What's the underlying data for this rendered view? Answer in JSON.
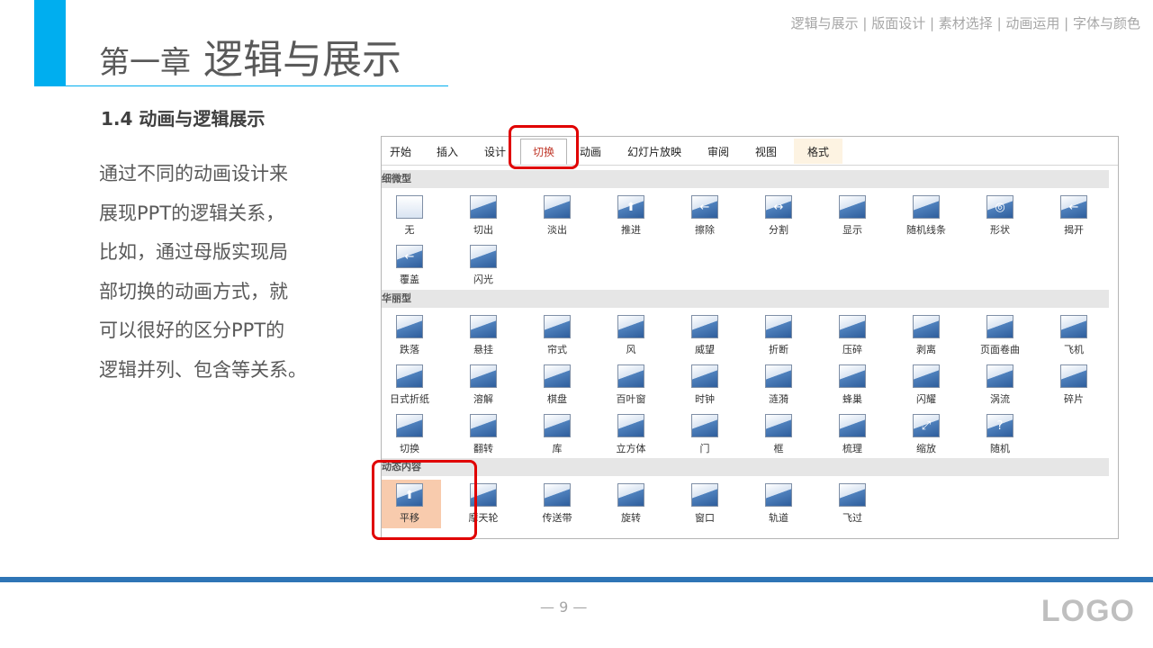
{
  "header": {
    "chapter": "第一章",
    "title": "逻辑与展示",
    "nav": "逻辑与展示 | 版面设计 | 素材选择 | 动画运用 | 字体与颜色"
  },
  "section_title": "1.4 动画与逻辑展示",
  "body_lines": [
    "通过不同的动画设计来",
    "展现PPT的逻辑关系，",
    "比如，通过母版实现局",
    "部切换的动画方式，就",
    "可以很好的区分PPT的",
    "逻辑并列、包含等关系。"
  ],
  "ribbon": {
    "tabs": [
      "开始",
      "插入",
      "设计",
      "切换",
      "动画",
      "幻灯片放映",
      "审阅",
      "视图",
      "格式"
    ],
    "active_tab": "切换",
    "categories": [
      {
        "name": "细微型",
        "items": [
          "无",
          "切出",
          "淡出",
          "推进",
          "擦除",
          "分割",
          "显示",
          "随机线条",
          "形状",
          "揭开",
          "覆盖",
          "闪光"
        ]
      },
      {
        "name": "华丽型",
        "items": [
          "跌落",
          "悬挂",
          "帘式",
          "风",
          "威望",
          "折断",
          "压碎",
          "剥离",
          "页面卷曲",
          "飞机",
          "日式折纸",
          "溶解",
          "棋盘",
          "百叶窗",
          "时钟",
          "涟漪",
          "蜂巢",
          "闪耀",
          "涡流",
          "碎片",
          "切换",
          "翻转",
          "库",
          "立方体",
          "门",
          "框",
          "梳理",
          "缩放",
          "随机"
        ]
      },
      {
        "name": "动态内容",
        "items": [
          "平移",
          "摩天轮",
          "传送带",
          "旋转",
          "窗口",
          "轨道",
          "飞过"
        ]
      }
    ],
    "selected_item": "平移"
  },
  "footer": {
    "page": "— 9 —",
    "logo": "LOGO"
  },
  "colors": {
    "accent": "#00AEEF",
    "footer_bar": "#2E75B6",
    "highlight": "#E00000",
    "selected_fill": "#F8CBAD"
  }
}
